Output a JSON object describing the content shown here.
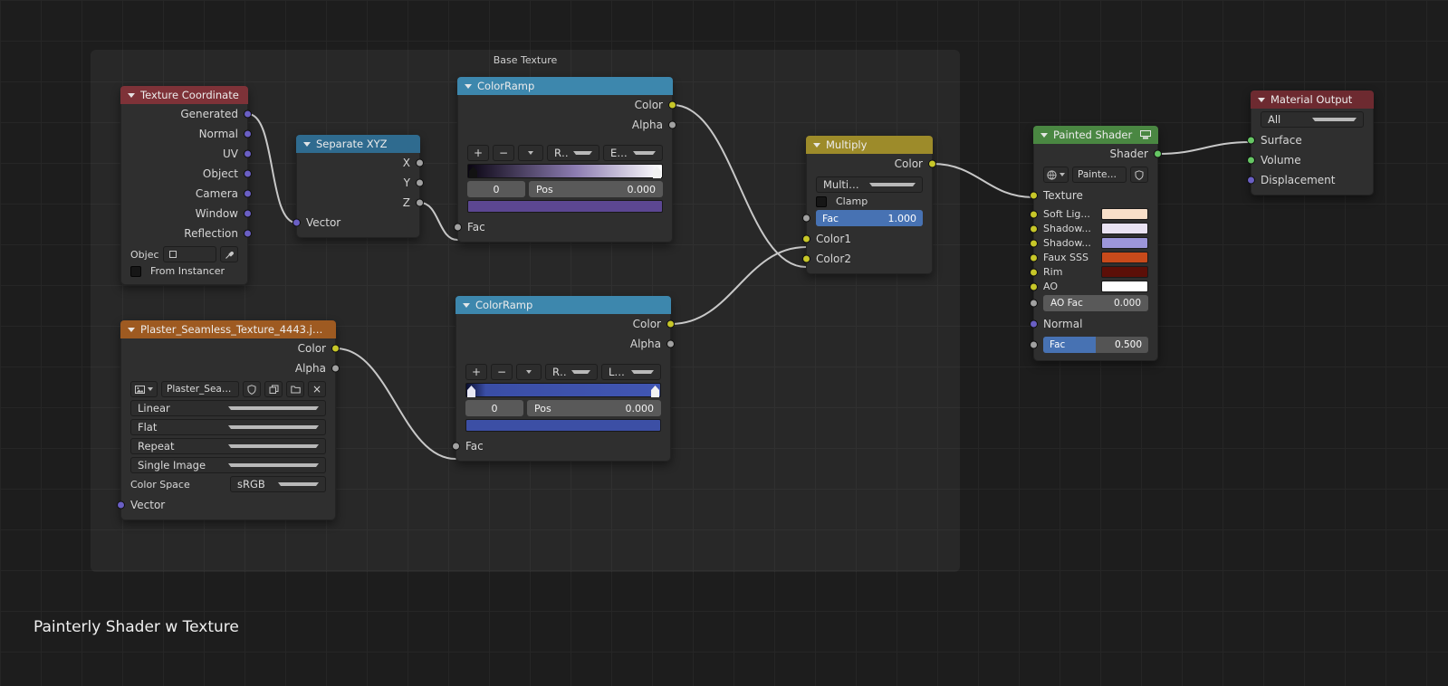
{
  "canvas": {
    "frame_label": "Base Texture",
    "caption": "Painterly Shader w Texture"
  },
  "icons": {
    "close": "×"
  },
  "colors": {
    "wire": "#d6d6d6",
    "header_input_red": "#7e3238",
    "header_output_red": "#6d2a30",
    "header_converter_blue": "#2f6b8f",
    "header_colorramp_blue": "#3d87ad",
    "header_texture_orange": "#9e5a21",
    "header_color_olive": "#9d8b2a",
    "header_group_green": "#4a8742",
    "socket_vector": "#6a5fc4",
    "socket_value": "#a1a1a1",
    "socket_color": "#c7c729",
    "socket_shader": "#66c664",
    "slider_blue": "#4772b3",
    "ramp1_gradient": "linear-gradient(90deg,#0a0512 0%,#8b7bb0 55%,#ffffff 100%)",
    "ramp1_swatch": "#5c4792",
    "ramp2_gradient": "linear-gradient(90deg,#0a0e2e 0%,#3a4ea6 10%,#4156b2 100%)",
    "ramp2_swatch": "#3c4fa5",
    "swatch_soft_light": "#f8dfc9",
    "swatch_shadow_1": "#e9e2f2",
    "swatch_shadow_2": "#9c96da",
    "swatch_faux_sss": "#c84a1b",
    "swatch_rim": "#5c0f08",
    "swatch_ao": "#ffffff"
  },
  "nodes": {
    "texture_coordinate": {
      "title": "Texture Coordinate",
      "outputs": [
        "Generated",
        "Normal",
        "UV",
        "Object",
        "Camera",
        "Window",
        "Reflection"
      ],
      "object_label": "Objec",
      "from_instancer_label": "From Instancer"
    },
    "separate_xyz": {
      "title": "Separate XYZ",
      "outputs": [
        "X",
        "Y",
        "Z"
      ],
      "input_vector": "Vector"
    },
    "colorramp_top": {
      "title": "ColorRamp",
      "outputs": [
        "Color",
        "Alpha"
      ],
      "btn_add": "+",
      "btn_remove": "−",
      "mode": "RGB",
      "interpolation": "Ease",
      "stop_index": "0",
      "pos_label": "Pos",
      "pos_value": "0.000",
      "input_fac": "Fac"
    },
    "colorramp_bottom": {
      "title": "ColorRamp",
      "outputs": [
        "Color",
        "Alpha"
      ],
      "btn_add": "+",
      "btn_remove": "−",
      "mode": "RGB",
      "interpolation": "Linear",
      "stop_index": "0",
      "pos_label": "Pos",
      "pos_value": "0.000",
      "input_fac": "Fac"
    },
    "image_texture": {
      "title": "Plaster_Seamless_Texture_4443.jpg...",
      "outputs": [
        "Color",
        "Alpha"
      ],
      "image_name": "Plaster_Seamle..",
      "interpolation": "Linear",
      "projection": "Flat",
      "extension": "Repeat",
      "source": "Single Image",
      "color_space_label": "Color Space",
      "color_space_value": "sRGB",
      "input_vector": "Vector"
    },
    "multiply": {
      "title": "Multiply",
      "output_color": "Color",
      "blend_mode": "Multiply",
      "clamp_label": "Clamp",
      "fac_label": "Fac",
      "fac_value": "1.000",
      "inputs": [
        "Color1",
        "Color2"
      ]
    },
    "painted_shader": {
      "title": "Painted Shader",
      "output_shader": "Shader",
      "group_name": "Painted ...",
      "input_texture": "Texture",
      "color_inputs": [
        "Soft Lig...",
        "Shadow...",
        "Shadow...",
        "Faux SSS",
        "Rim",
        "AO"
      ],
      "ao_fac_label": "AO Fac",
      "ao_fac_value": "0.000",
      "input_normal": "Normal",
      "fac_label": "Fac",
      "fac_value": "0.500"
    },
    "material_output": {
      "title": "Material Output",
      "target": "All",
      "inputs": [
        "Surface",
        "Volume",
        "Displacement"
      ]
    }
  }
}
